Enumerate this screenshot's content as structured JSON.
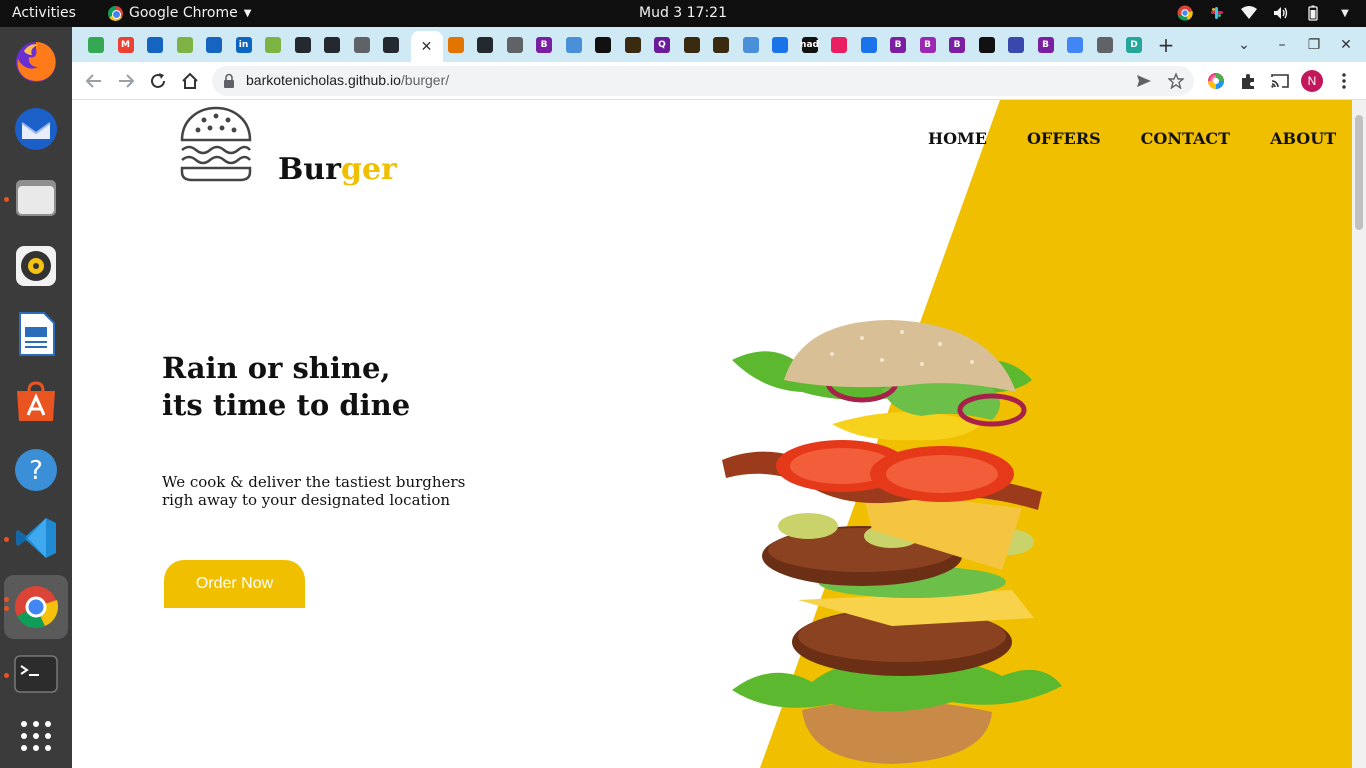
{
  "topbar": {
    "activities": "Activities",
    "app_name": "Google Chrome",
    "clock": "Mud 3  17:21"
  },
  "dock": {
    "items": [
      "firefox-icon",
      "thunderbird-icon",
      "files-icon",
      "rhythmbox-icon",
      "writer-icon",
      "app-center-icon",
      "help-icon",
      "vscode-icon",
      "chrome-icon",
      "terminal-icon",
      "show-apps-icon"
    ]
  },
  "browser": {
    "url_host": "barkotenicholas.github.io",
    "url_path": "/burger/",
    "profile_initial": "N",
    "tab_favicons": [
      {
        "label": "",
        "color": "#34a853"
      },
      {
        "label": "M",
        "color": "#ea4335"
      },
      {
        "label": "",
        "color": "#1565c0"
      },
      {
        "label": "",
        "color": "#7cb342"
      },
      {
        "label": "",
        "color": "#1565c0"
      },
      {
        "label": "in",
        "color": "#0a66c2"
      },
      {
        "label": "",
        "color": "#7cb342"
      },
      {
        "label": "",
        "color": "#24292f"
      },
      {
        "label": "",
        "color": "#24292f"
      },
      {
        "label": "",
        "color": "#5f6368"
      },
      {
        "label": "",
        "color": "#24292f"
      },
      {
        "label": "",
        "color": "#e37400"
      },
      {
        "label": "",
        "color": "#24292f"
      },
      {
        "label": "",
        "color": "#5f6368"
      },
      {
        "label": "B",
        "color": "#7b1fa2"
      },
      {
        "label": "",
        "color": "#4a90d9"
      },
      {
        "label": "",
        "color": "#111111"
      },
      {
        "label": "",
        "color": "#3a2a10"
      },
      {
        "label": "Q",
        "color": "#6a1b9a"
      },
      {
        "label": "",
        "color": "#3a2a10"
      },
      {
        "label": "",
        "color": "#3a2a10"
      },
      {
        "label": "",
        "color": "#4a90d9"
      },
      {
        "label": "",
        "color": "#1a73e8"
      },
      {
        "label": "nad",
        "color": "#111111"
      },
      {
        "label": "",
        "color": "#e91e63"
      },
      {
        "label": "",
        "color": "#1a73e8"
      },
      {
        "label": "B",
        "color": "#7b1fa2"
      },
      {
        "label": "B",
        "color": "#9c27b0"
      },
      {
        "label": "B",
        "color": "#7b1fa2"
      },
      {
        "label": "",
        "color": "#111111"
      },
      {
        "label": "",
        "color": "#3949ab"
      },
      {
        "label": "B",
        "color": "#7b1fa2"
      },
      {
        "label": "",
        "color": "#4285f4"
      },
      {
        "label": "",
        "color": "#5f6368"
      },
      {
        "label": "D",
        "color": "#26a69a"
      }
    ]
  },
  "page": {
    "brand_first": "Bur",
    "brand_second": "ger",
    "nav": [
      "HOME",
      "OFFERS",
      "CONTACT",
      "ABOUT"
    ],
    "headline_line1": "Rain or shine,",
    "headline_line2": "its time to dine",
    "subtext_line1": "We cook & deliver the tastiest burghers",
    "subtext_line2": "righ away to your designated location",
    "cta": "Order Now"
  },
  "colors": {
    "accent": "#f0c000",
    "tabstrip": "#cfe9f5",
    "dock": "#3b3b3b"
  }
}
